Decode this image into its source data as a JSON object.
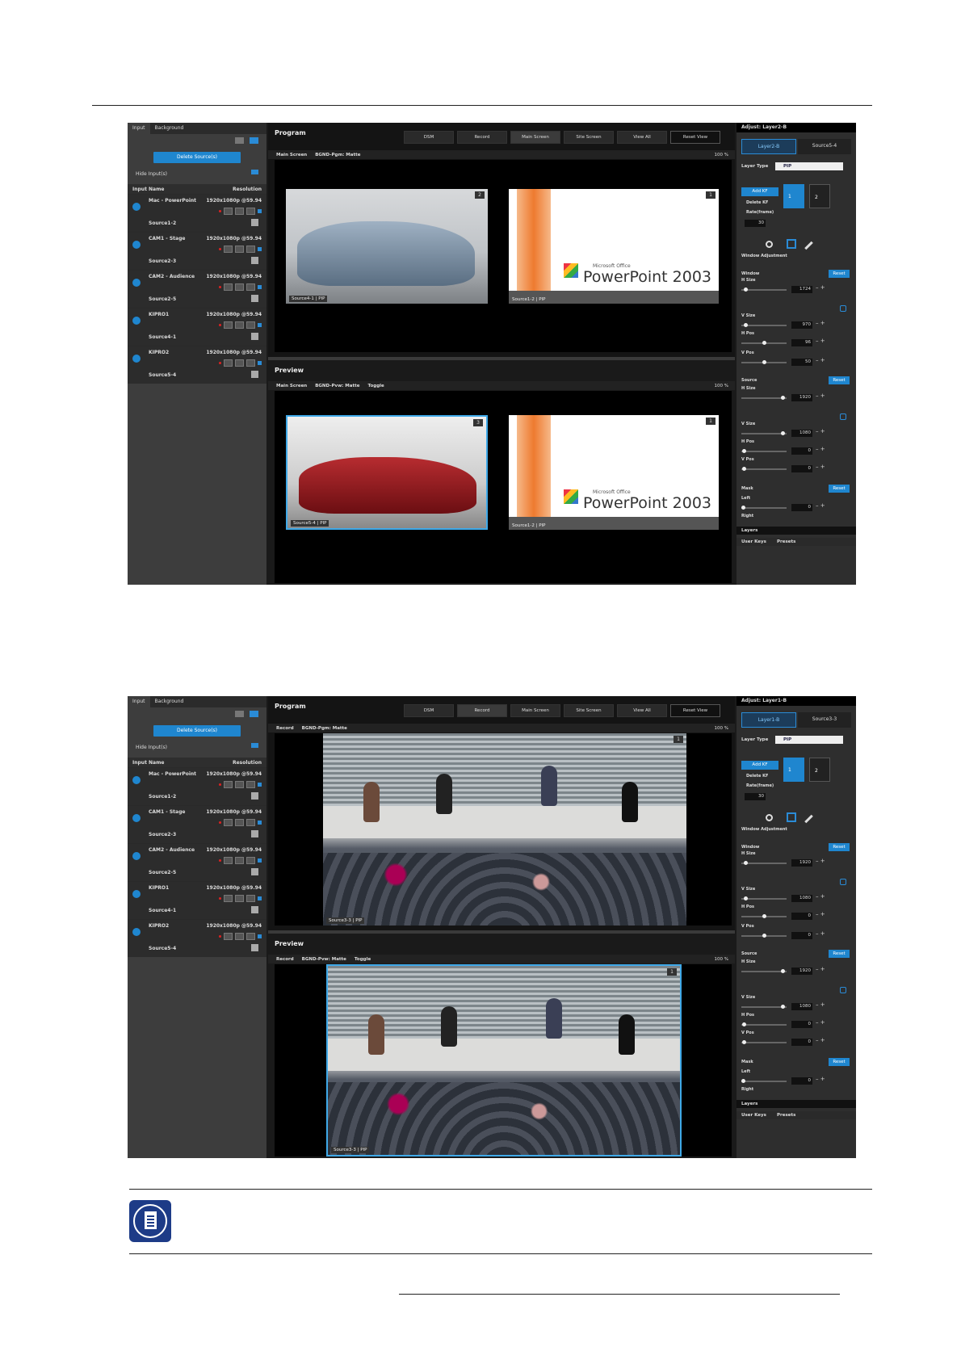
{
  "screens": [
    {
      "input_tab": "Input",
      "background_tab": "Background",
      "delete_label": "Delete Source(s)",
      "hide_label": "Hide Input(s)",
      "col_name": "Input Name",
      "col_res": "Resolution",
      "sources": [
        {
          "name": "Mac - PowerPoint",
          "res": "1920x1080p @59.94",
          "next": "Source1-2"
        },
        {
          "name": "CAM1 - Stage",
          "res": "1920x1080p @59.94",
          "next": "Source2-3"
        },
        {
          "name": "CAM2 - Audience",
          "res": "1920x1080p @59.94",
          "next": "Source2-5"
        },
        {
          "name": "KIPRO1",
          "res": "1920x1080p @59.94",
          "next": "Source4-1"
        },
        {
          "name": "KIPRO2",
          "res": "1920x1080p @59.94",
          "next": "Source5-4"
        }
      ],
      "program_title": "Program",
      "preview_title": "Preview",
      "buttons": [
        "DSM",
        "Record",
        "Main Screen",
        "Site Screen",
        "View All",
        "Reset View"
      ],
      "program_bar": [
        "Main Screen",
        "BGND-Pgm: Matte"
      ],
      "preview_bar": [
        "Main Screen",
        "BGND-Pvw: Matte",
        "Toggle"
      ],
      "zoom": "100 %",
      "program_tiles": [
        {
          "label": "Source4-1 | PIP",
          "num": "2"
        },
        {
          "label": "Source1-2 | PIP",
          "num": "1"
        }
      ],
      "preview_tiles": [
        {
          "label": "Source5-4 | PIP",
          "num": "3"
        },
        {
          "label": "Source1-2 | PIP",
          "num": "1"
        }
      ],
      "ppt_small": "Microsoft Office",
      "ppt_big": "PowerPoint 2003",
      "adjust_title": "Adjust: Layer2-B",
      "layer_tabs": [
        "Layer2-B",
        "Source5-4"
      ],
      "layer_type_label": "Layer Type",
      "layer_type_value": "PIP",
      "add_kf": "Add KF",
      "delete_kf": "Delete KF",
      "rate_label": "Rate(frame)",
      "rate_value": "30",
      "kf1": "1",
      "kf2": "2",
      "window_adj": "Window Adjustment",
      "window_label": "Window",
      "reset": "Reset",
      "hsize": "H Size",
      "vsize": "V Size",
      "hpos": "H Pos",
      "vpos": "V Pos",
      "source_label": "Source",
      "mask_label": "Mask",
      "left_label": "Left",
      "right_label": "Right",
      "win_values": [
        "1724",
        "970",
        "96",
        "50"
      ],
      "src_values": [
        "1920",
        "1080",
        "0",
        "0"
      ],
      "mask_value": "0",
      "layers_tab": "Layers",
      "user_keys": "User Keys",
      "presets": "Presets"
    },
    {
      "input_tab": "Input",
      "background_tab": "Background",
      "delete_label": "Delete Source(s)",
      "hide_label": "Hide Input(s)",
      "col_name": "Input Name",
      "col_res": "Resolution",
      "sources": [
        {
          "name": "Mac - PowerPoint",
          "res": "1920x1080p @59.94",
          "next": "Source1-2"
        },
        {
          "name": "CAM1 - Stage",
          "res": "1920x1080p @59.94",
          "next": "Source2-3"
        },
        {
          "name": "CAM2 - Audience",
          "res": "1920x1080p @59.94",
          "next": "Source2-5"
        },
        {
          "name": "KIPRO1",
          "res": "1920x1080p @59.94",
          "next": "Source4-1"
        },
        {
          "name": "KIPRO2",
          "res": "1920x1080p @59.94",
          "next": "Source5-4"
        }
      ],
      "program_title": "Program",
      "preview_title": "Preview",
      "buttons": [
        "DSM",
        "Record",
        "Main Screen",
        "Site Screen",
        "View All",
        "Reset View"
      ],
      "program_bar": [
        "Record",
        "BGND-Pgm: Matte"
      ],
      "preview_bar": [
        "Record",
        "BGND-Pvw: Matte",
        "Toggle"
      ],
      "zoom": "100 %",
      "program_tiles": [
        {
          "label": "Source3-3 | PIP",
          "num": "1"
        }
      ],
      "preview_tiles": [
        {
          "label": "Source3-3 | PIP",
          "num": "1"
        }
      ],
      "adjust_title": "Adjust: Layer1-B",
      "layer_tabs": [
        "Layer1-B",
        "Source3-3"
      ],
      "layer_type_label": "Layer Type",
      "layer_type_value": "PIP",
      "add_kf": "Add KF",
      "delete_kf": "Delete KF",
      "rate_label": "Rate(frame)",
      "rate_value": "30",
      "kf1": "1",
      "kf2": "2",
      "window_adj": "Window Adjustment",
      "window_label": "Window",
      "reset": "Reset",
      "hsize": "H Size",
      "vsize": "V Size",
      "hpos": "H Pos",
      "vpos": "V Pos",
      "source_label": "Source",
      "mask_label": "Mask",
      "left_label": "Left",
      "right_label": "Right",
      "win_values": [
        "1920",
        "1080",
        "0",
        "0"
      ],
      "src_values": [
        "1920",
        "1080",
        "0",
        "0"
      ],
      "mask_value": "0",
      "layers_tab": "Layers",
      "user_keys": "User Keys",
      "presets": "Presets"
    }
  ],
  "note_icon": "note-icon"
}
